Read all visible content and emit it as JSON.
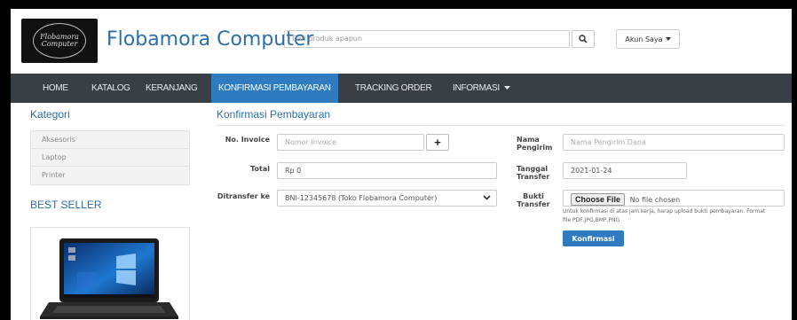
{
  "header": {
    "brand": "Flobamora Computer",
    "logo_text": "Flobamora Computer",
    "search_placeholder": "Cari produk apapun",
    "account_label": "Akun Saya"
  },
  "nav": {
    "items": [
      {
        "label": "HOME"
      },
      {
        "label": "KATALOG"
      },
      {
        "label": "KERANJANG"
      },
      {
        "label": "KONFIRMASI PEMBAYARAN"
      },
      {
        "label": "TRACKING ORDER"
      },
      {
        "label": "INFORMASI"
      }
    ],
    "active_index": 3
  },
  "sidebar": {
    "category_title": "Kategori",
    "categories": [
      "Aksesoris",
      "Laptop",
      "Printer"
    ],
    "bestseller_title": "BEST SELLER"
  },
  "main": {
    "title": "Konfirmasi Pembayaran",
    "invoice": {
      "label": "No. Invoice",
      "placeholder": "Nomor Invoice"
    },
    "total": {
      "label": "Total",
      "value": "Rp 0"
    },
    "transfer_to": {
      "label": "Ditransfer ke",
      "value": "BNI-12345678 (Toko Flobamora Computer)"
    },
    "sender": {
      "label": "Nama Pengirim",
      "placeholder": "Nama Pengirim Dana"
    },
    "date": {
      "label": "Tanggal Transfer",
      "value": "2021-01-24"
    },
    "proof": {
      "label": "Bukti Transfer",
      "button": "Choose File",
      "status": "No file chosen",
      "help": "Untuk konfirmasi di atas jam kerja, harap upload bukti pembayaran. Format file PDF,JPG,BMP,PNG"
    },
    "confirm_button": "Konfirmasi"
  },
  "colors": {
    "accent": "#2f7bbf",
    "navbar": "#3a3f45",
    "brand": "#2c6fa8"
  }
}
